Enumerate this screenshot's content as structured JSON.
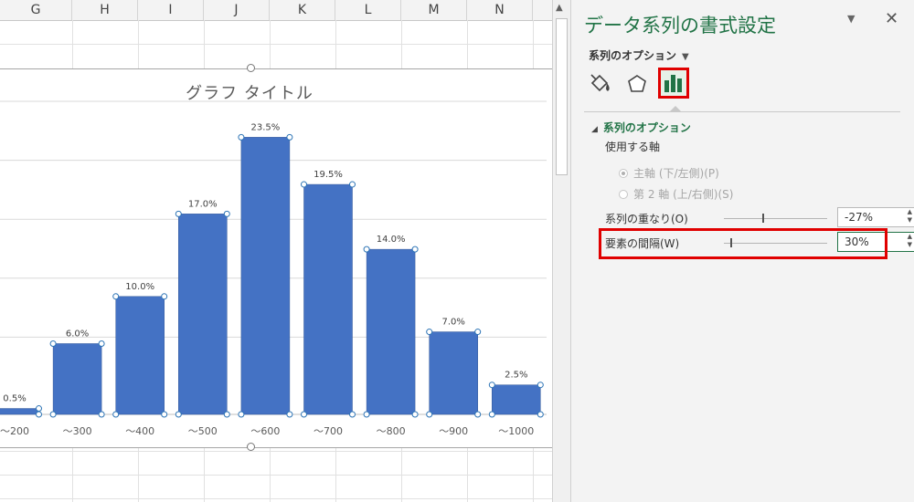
{
  "sheet": {
    "columns": [
      "G",
      "H",
      "I",
      "J",
      "K",
      "L",
      "M",
      "N"
    ]
  },
  "chart": {
    "title": "グラフ タイトル"
  },
  "chart_data": {
    "type": "bar",
    "title": "グラフ タイトル",
    "categories": [
      "〜200",
      "〜300",
      "〜400",
      "〜500",
      "〜600",
      "〜700",
      "〜800",
      "〜900",
      "〜1000"
    ],
    "values": [
      0.5,
      6.0,
      10.0,
      17.0,
      23.5,
      19.5,
      14.0,
      7.0,
      2.5
    ],
    "data_labels": [
      "0.5%",
      "6.0%",
      "10.0%",
      "17.0%",
      "23.5%",
      "19.5%",
      "14.0%",
      "7.0%",
      "2.5%"
    ],
    "ylim": [
      0,
      25
    ],
    "grid": true,
    "bar_color": "#4472c4"
  },
  "pane": {
    "title": "データ系列の書式設定",
    "series_options_menu": "系列のオプション",
    "section_header": "系列のオプション",
    "axis_label": "使用する軸",
    "primary_axis": "主軸 (下/左側)(P)",
    "secondary_axis": "第 2 軸 (上/右側)(S)",
    "overlap_label": "系列の重なり(O)",
    "overlap_value": "-27%",
    "overlap_level": 0.37,
    "gap_label": "要素の間隔(W)",
    "gap_value": "30%",
    "gap_level": 0.06,
    "accent_color": "#217346",
    "highlight_color": "#e00000",
    "icons": [
      "fill-line-icon",
      "effects-icon",
      "series-options-icon",
      "close-icon",
      "dropdown-arrow-icon"
    ]
  }
}
